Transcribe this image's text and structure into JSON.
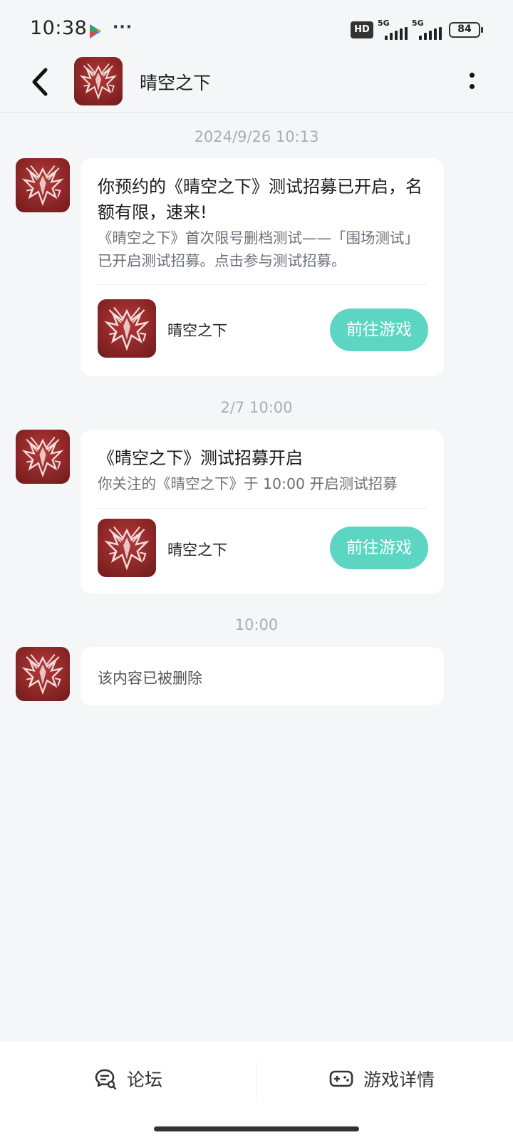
{
  "status_bar": {
    "time": "10:38",
    "overflow": "···",
    "hd_label": "HD",
    "sim1_label": "5G",
    "sim2_label": "5G",
    "battery": "84",
    "icons": [
      "play-store-icon",
      "signal-icon",
      "battery-icon"
    ]
  },
  "header": {
    "title": "晴空之下",
    "icons": [
      "back-arrow-icon",
      "more-vertical-icon"
    ]
  },
  "messages": [
    {
      "timestamp": "2024/9/26  10:13",
      "title": "你预约的《晴空之下》测试招募已开启，名额有限，速来!",
      "body": "《晴空之下》首次限号删档测试——「围场测试」已开启测试招募。点击参与测试招募。",
      "game_name": "晴空之下",
      "button_label": "前往游戏"
    },
    {
      "timestamp": "2/7  10:00",
      "title": "《晴空之下》测试招募开启",
      "body": "你关注的《晴空之下》于 10:00 开启测试招募",
      "game_name": "晴空之下",
      "button_label": "前往游戏"
    },
    {
      "timestamp": "10:00",
      "deleted_text": "该内容已被删除"
    }
  ],
  "bottom_bar": {
    "forum_label": "论坛",
    "details_label": "游戏详情"
  },
  "colors": {
    "background": "#f5f6f8",
    "accent_button": "#5dd5c3",
    "app_icon_red": "#8c2626"
  }
}
